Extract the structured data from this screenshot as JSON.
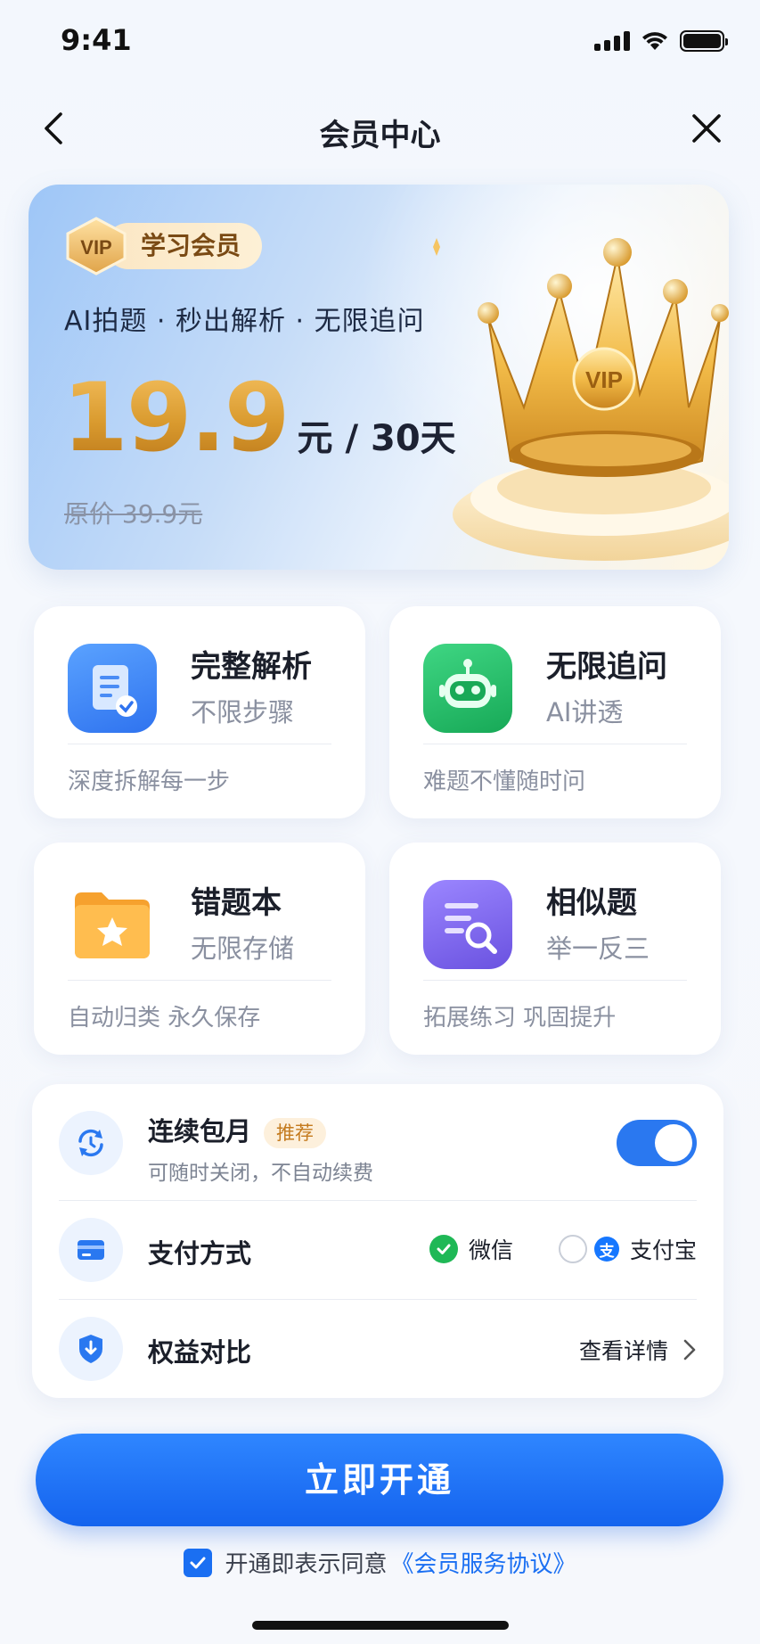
{
  "status_bar": {
    "time": "9:41"
  },
  "nav": {
    "title": "会员中心"
  },
  "hero": {
    "badge_icon_text": "VIP",
    "badge_label": "学习会员",
    "slogan": "AI拍题 · 秒出解析 · 无限追问",
    "price": "19.9",
    "price_unit": "元 / 30天",
    "original_price": "原价 39.9元",
    "crown_text": "VIP"
  },
  "features": [
    {
      "title": "完整解析",
      "subtitle": "不限步骤",
      "desc": "深度拆解每一步",
      "icon": "document-check-icon",
      "color": "#3b86f5"
    },
    {
      "title": "无限追问",
      "subtitle": "AI讲透",
      "desc": "难题不懂随时问",
      "icon": "robot-icon",
      "color": "#27c46d"
    },
    {
      "title": "错题本",
      "subtitle": "无限存储",
      "desc": "自动归类 永久保存",
      "icon": "star-folder-icon",
      "color": "#f8a030"
    },
    {
      "title": "相似题",
      "subtitle": "举一反三",
      "desc": "拓展练习 巩固提升",
      "icon": "search-list-icon",
      "color": "#7a63e8"
    }
  ],
  "options": {
    "auto_renew": {
      "label": "连续包月",
      "tag": "推荐",
      "sub": "可随时关闭，不自动续费",
      "enabled": true
    },
    "payment": {
      "label": "支付方式",
      "methods": [
        {
          "name": "微信",
          "selected": true
        },
        {
          "name": "支付宝",
          "selected": false,
          "icon_text": "支"
        }
      ]
    },
    "benefits": {
      "label": "权益对比",
      "link": "查看详情"
    }
  },
  "cta": {
    "label": "立即开通"
  },
  "agreement": {
    "checked": true,
    "text": "开通即表示同意",
    "link": "《会员服务协议》"
  },
  "colors": {
    "primary": "#1a6ff2",
    "gold": "#d99a2e",
    "wechat": "#1fb856",
    "alipay": "#1677ff"
  }
}
